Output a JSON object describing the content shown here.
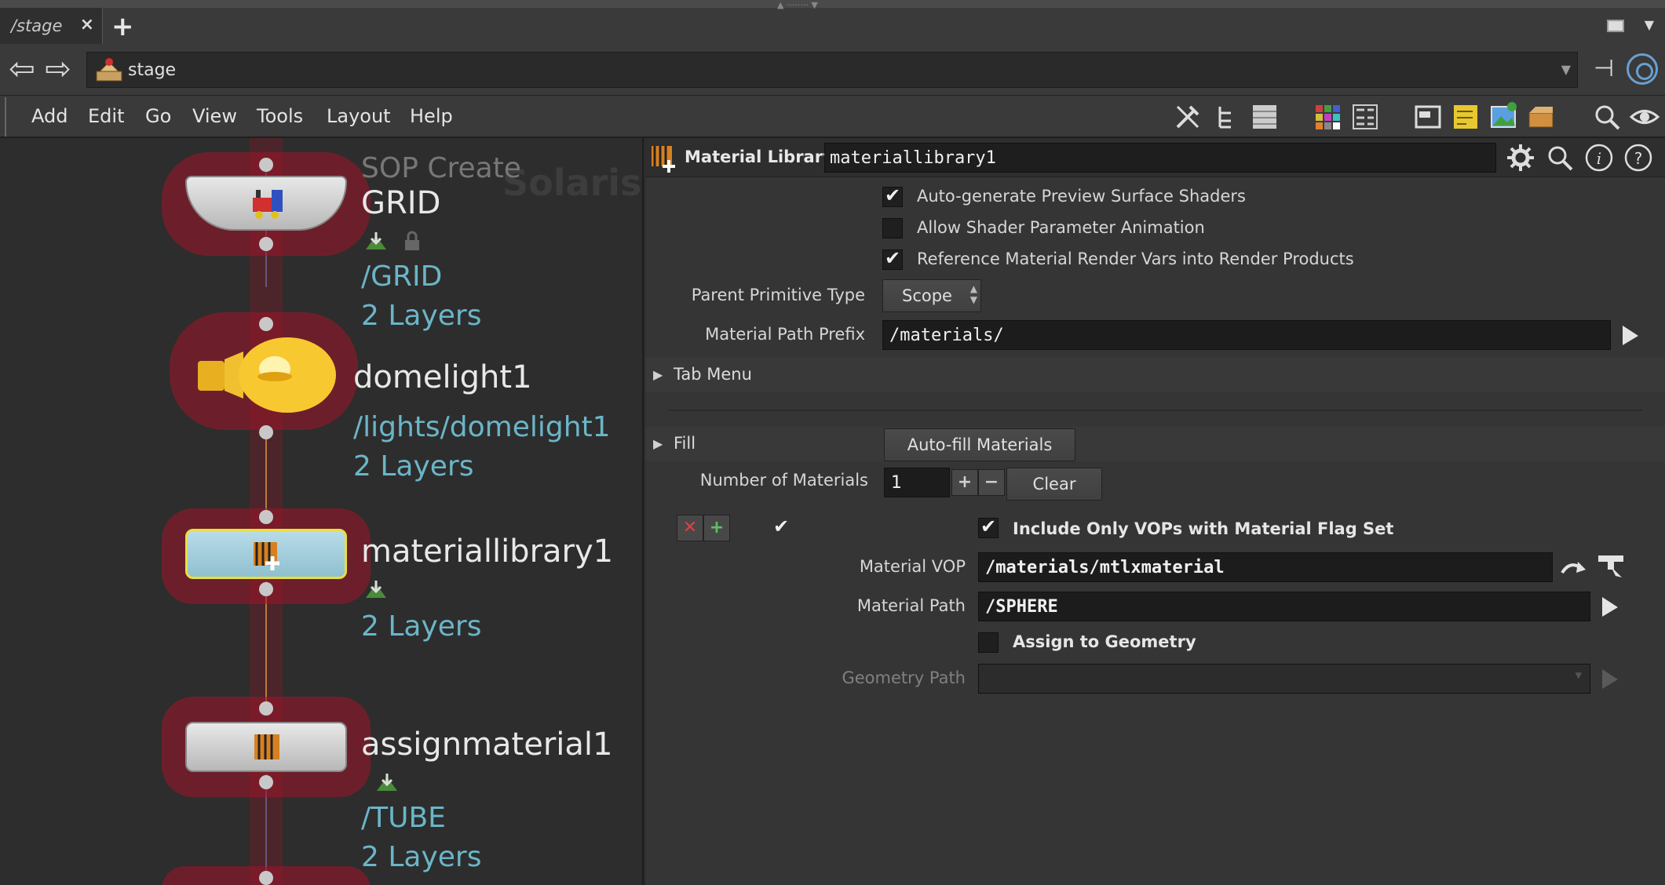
{
  "tab": {
    "label": "/stage",
    "close": "×",
    "add": "+"
  },
  "path": {
    "text": "stage"
  },
  "menu": [
    "Add",
    "Edit",
    "Go",
    "View",
    "Tools",
    "Layout",
    "Help"
  ],
  "network": {
    "watermark": "Solaris",
    "nodes": [
      {
        "type_label": "SOP Create",
        "name": "GRID",
        "path": "/GRID",
        "layers": "2 Layers"
      },
      {
        "name": "domelight1",
        "path": "/lights/domelight1",
        "layers": "2 Layers"
      },
      {
        "name": "materiallibrary1",
        "layers": "2 Layers"
      },
      {
        "name": "assignmaterial1",
        "path": "/TUBE",
        "layers": "2 Layers"
      }
    ]
  },
  "parm": {
    "node_type": "Material Library",
    "node_name": "materiallibrary1",
    "auto_preview": {
      "label": "Auto-generate Preview Surface Shaders",
      "checked": true
    },
    "allow_anim": {
      "label": "Allow Shader Parameter Animation",
      "checked": false
    },
    "ref_render_vars": {
      "label": "Reference Material Render Vars into Render Products",
      "checked": true
    },
    "parent_prim_type": {
      "label": "Parent Primitive Type",
      "value": "Scope"
    },
    "mat_path_prefix": {
      "label": "Material Path Prefix",
      "value": "/materials/"
    },
    "tab_menu": "Tab Menu",
    "fill": "Fill",
    "autofill_button": "Auto-fill Materials",
    "num_materials": {
      "label": "Number of Materials",
      "value": "1",
      "plus": "+",
      "minus": "−",
      "clear": "Clear"
    },
    "include_only_vops": {
      "label": "Include Only VOPs with Material Flag Set",
      "checked": true
    },
    "material_vop": {
      "label": "Material VOP",
      "value": "/materials/mtlxmaterial"
    },
    "material_path": {
      "label": "Material Path",
      "value": "/SPHERE"
    },
    "assign_geo": {
      "label": "Assign to Geometry",
      "checked": false
    },
    "geo_path": {
      "label": "Geometry Path",
      "value": ""
    }
  },
  "colors": {
    "accent_wire": "#c8a040",
    "node_glow": "#a01428",
    "selected_node": "#a8d0e0",
    "path_text": "#6bb5c8"
  }
}
